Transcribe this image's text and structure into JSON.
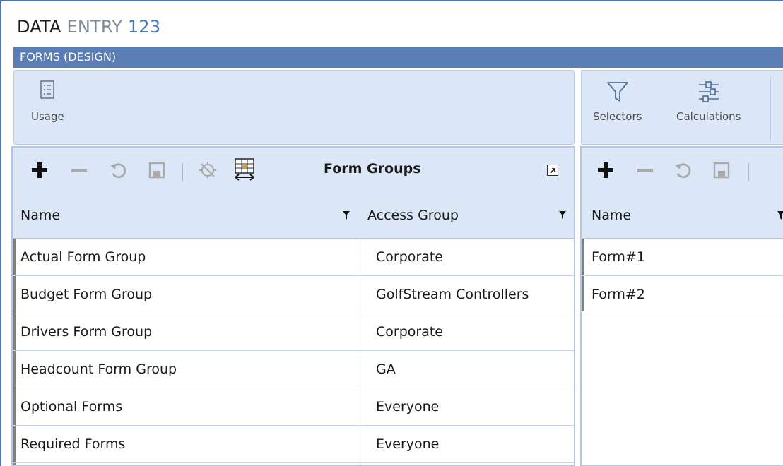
{
  "app": {
    "title_part1": "DATA",
    "title_part2": "ENTRY",
    "title_part3": "123"
  },
  "section": {
    "label": "FORMS (DESIGN)"
  },
  "ribbon": {
    "left": {
      "usage_label": "Usage"
    },
    "right": {
      "selectors_label": "Selectors",
      "calculations_label": "Calculations"
    }
  },
  "form_groups": {
    "title": "Form Groups",
    "columns": {
      "name": "Name",
      "access_group": "Access Group"
    },
    "rows": [
      {
        "name": "Actual Form Group",
        "access_group": "Corporate"
      },
      {
        "name": "Budget Form Group",
        "access_group": "GolfStream Controllers"
      },
      {
        "name": "Drivers Form Group",
        "access_group": "Corporate"
      },
      {
        "name": "Headcount Form Group",
        "access_group": "GA"
      },
      {
        "name": "Optional Forms",
        "access_group": "Everyone"
      },
      {
        "name": "Required Forms",
        "access_group": "Everyone"
      }
    ]
  },
  "forms": {
    "columns": {
      "name": "Name"
    },
    "rows": [
      {
        "name": "Form#1"
      },
      {
        "name": "Form#2"
      }
    ]
  },
  "colors": {
    "accent": "#5a7db4",
    "ribbon_bg": "#dbe6f7",
    "title_accent": "#3f79c2"
  },
  "icons": [
    "list-icon",
    "funnel-icon",
    "sliders-icon",
    "plus-icon",
    "minus-icon",
    "refresh-icon",
    "save-icon",
    "no-target-icon",
    "resize-columns-icon",
    "expand-icon",
    "filter-icon"
  ]
}
